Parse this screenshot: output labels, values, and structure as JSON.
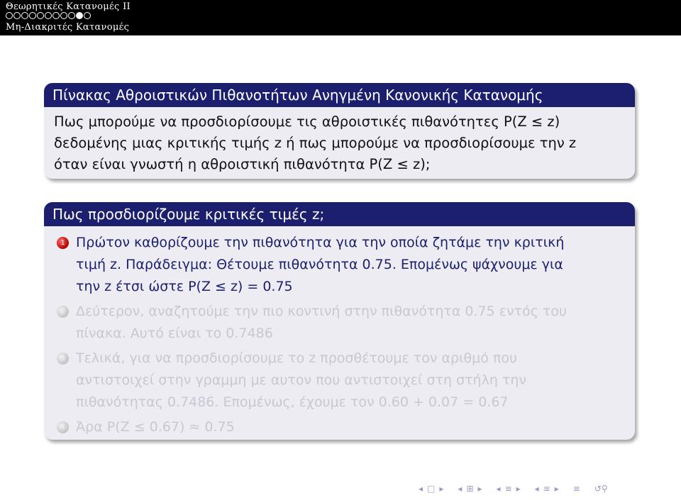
{
  "header": {
    "title": "Θεωρητικές Κατανομές II",
    "progress": {
      "total": 11,
      "current": 10
    },
    "subsection": "Μη-Διακριτές Κατανομές"
  },
  "block1": {
    "title": "Πίνακας Αθροιστικών Πιθανοτήτων Ανηγμένη Κανονικής Κατανομής",
    "lines": [
      "Πως μπορούμε να προσδιορίσουμε τις αθροιστικές πιθανότητες P(Z ≤ z)",
      "δεδομένης μιας κριτικής τιμής z ή πως μπορούμε να προσδιορίσουμε την z",
      "όταν είναι γνωστή η αθροιστική πιθανότητα P(Z ≤ z);"
    ]
  },
  "block2": {
    "title": "Πως προσδιορίζουμε κριτικές τιμές z;",
    "items": [
      {
        "number": "1",
        "state": "active",
        "lines": [
          "Πρώτον καθορίζουμε την πιθανότητα για την οποία ζητάμε την κριτική",
          "τιμή z. Παράδειγμα: Θέτουμε πιθανότητα 0.75. Επομένως ψάχνουμε για",
          "την z έτσι ώστε P(Z ≤ z) = 0.75"
        ]
      },
      {
        "number": "2",
        "state": "faded",
        "lines": [
          "Δεύτερον, αναζητούμε την πιο κοντινή στην πιθανότητα 0.75 εντός του",
          "πίνακα. Αυτό είναι το 0.7486"
        ]
      },
      {
        "number": "3",
        "state": "faded",
        "lines": [
          "Τελικά, για να προσδιορίσουμε το z προσθέτουμε τον αριθμό που",
          "αντιστοιχεί στην γραμμη με αυτον που αντιστοιχεί στη στήλη την",
          "πιθανότητας 0.7486. Επομένως, έχουμε τον 0.60 + 0.07 = 0.67"
        ]
      },
      {
        "number": "4",
        "state": "faded",
        "lines": [
          "Άρα P(Z ≤ 0.67) ≈ 0.75"
        ]
      }
    ]
  },
  "nav": {
    "icons": [
      "nav-prev-frame-icon",
      "nav-next-frame-icon",
      "nav-prev-subsection-icon",
      "nav-next-subsection-icon",
      "nav-prev-section-icon",
      "nav-next-section-icon",
      "nav-align-icon",
      "nav-search-icon"
    ],
    "accent": "#9a9ac0"
  },
  "colors": {
    "block_title_bg": "#1c1f6e",
    "block_body_bg": "#ececf2",
    "active_text": "#1c1f6e",
    "faded_text": "#c8c8d4",
    "bullet_active": "#c00000"
  }
}
